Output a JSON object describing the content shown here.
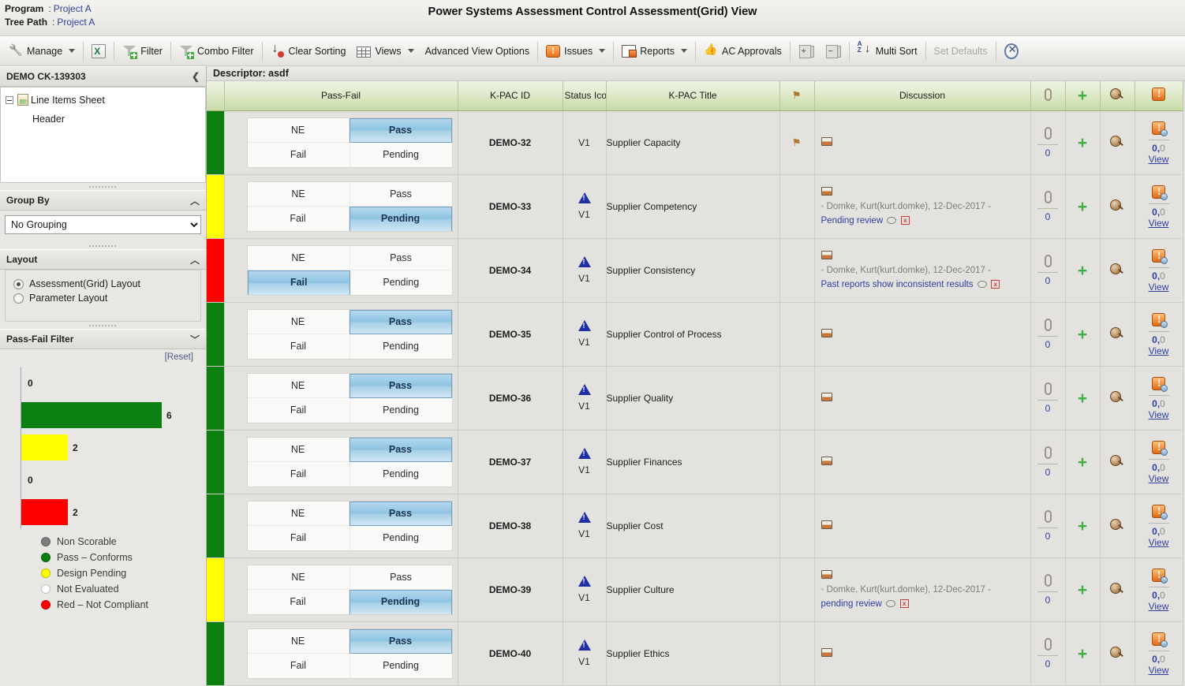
{
  "header": {
    "program_label": "Program",
    "program_value": "Project A",
    "treepath_label": "Tree Path",
    "treepath_value": "Project A",
    "separator": ":",
    "title": "Power Systems Assessment Control Assessment(Grid) View"
  },
  "toolbar": {
    "items": [
      {
        "label": "Manage",
        "icon": "wrench-icon",
        "caret": true,
        "disabled": false
      },
      {
        "label": "",
        "icon": "excel-export-icon",
        "caret": false,
        "disabled": false
      },
      {
        "label": "Filter",
        "icon": "filter-icon",
        "caret": false,
        "disabled": false
      },
      {
        "label": "Combo Filter",
        "icon": "combo-filter-icon",
        "caret": false,
        "disabled": false
      },
      {
        "label": "Clear Sorting",
        "icon": "clear-sorting-icon",
        "caret": false,
        "disabled": false
      },
      {
        "label": "Views",
        "icon": "views-grid-icon",
        "caret": true,
        "disabled": false
      },
      {
        "label": "Advanced View Options",
        "icon": "",
        "caret": false,
        "disabled": false
      },
      {
        "label": "Issues",
        "icon": "issues-icon",
        "caret": true,
        "disabled": false
      },
      {
        "label": "Reports",
        "icon": "reports-icon",
        "caret": true,
        "disabled": false
      },
      {
        "label": "AC Approvals",
        "icon": "thumbs-up-icon",
        "caret": false,
        "disabled": false
      },
      {
        "label": "",
        "icon": "add-copy-icon",
        "caret": false,
        "disabled": true
      },
      {
        "label": "",
        "icon": "remove-copy-icon",
        "caret": false,
        "disabled": true
      },
      {
        "label": "Multi Sort",
        "icon": "sort-az-icon",
        "caret": false,
        "disabled": false
      },
      {
        "label": "Set Defaults",
        "icon": "",
        "caret": false,
        "disabled": true
      },
      {
        "label": "",
        "icon": "close-circle-icon",
        "caret": false,
        "disabled": false
      }
    ]
  },
  "sidebar": {
    "tree_panel": {
      "title": "DEMO CK-139303",
      "collapse_icon": "chevron-left-icon",
      "root_label": "Line Items Sheet",
      "child_label": "Header"
    },
    "group_by": {
      "title": "Group By",
      "chevron": "chevron-up-icon",
      "selected": "No Grouping",
      "options": [
        "No Grouping"
      ]
    },
    "layout": {
      "title": "Layout",
      "chevron": "chevron-up-icon",
      "options": [
        {
          "label": "Assessment(Grid) Layout",
          "selected": true
        },
        {
          "label": "Parameter Layout",
          "selected": false
        }
      ]
    },
    "pass_fail_filter": {
      "title": "Pass-Fail Filter",
      "chevron": "chevron-down-icon",
      "reset_label": "[Reset]"
    }
  },
  "chart_data": {
    "type": "bar",
    "orientation": "horizontal",
    "title": "Pass-Fail Filter",
    "categories": [
      "Non Scorable",
      "Pass – Conforms",
      "Design Pending",
      "Not Evaluated",
      "Red – Not Compliant"
    ],
    "values": [
      0,
      6,
      2,
      0,
      2
    ],
    "colors": [
      "#7d7d7d",
      "#0b8010",
      "#ffff00",
      "#ffffff",
      "#ff0000"
    ],
    "value_labels": [
      "0",
      "6",
      "2",
      "0",
      "2"
    ],
    "xlabel": "",
    "ylabel": "",
    "xlim": [
      0,
      6
    ],
    "grid": false,
    "legend": [
      {
        "label": "Non Scorable",
        "color": "#7d7d7d"
      },
      {
        "label": "Pass – Conforms",
        "color": "#0b8010"
      },
      {
        "label": "Design Pending",
        "color": "#ffff00"
      },
      {
        "label": "Not Evaluated",
        "color": "#ffffff"
      },
      {
        "label": "Red – Not Compliant",
        "color": "#ff0000"
      }
    ],
    "legend_position": "below"
  },
  "grid": {
    "descriptor_label": "Descriptor: asdf",
    "columns": [
      {
        "key": "swatch",
        "label": ""
      },
      {
        "key": "passfail",
        "label": "Pass-Fail"
      },
      {
        "key": "kpac_id",
        "label": "K-PAC ID"
      },
      {
        "key": "status",
        "label": "Status Ico"
      },
      {
        "key": "title",
        "label": "K-PAC Title"
      },
      {
        "key": "flag",
        "label": "",
        "icon": "flag-icon"
      },
      {
        "key": "discussion",
        "label": "Discussion"
      },
      {
        "key": "attach",
        "label": "",
        "icon": "paperclip-icon"
      },
      {
        "key": "add",
        "label": "",
        "icon": "plus-icon"
      },
      {
        "key": "inspect",
        "label": "",
        "icon": "magnifier-icon"
      },
      {
        "key": "issues",
        "label": "",
        "icon": "issue-icon"
      }
    ],
    "passfail_options": {
      "ne": "NE",
      "pass": "Pass",
      "fail": "Fail",
      "pending": "Pending"
    },
    "attach_count": "0",
    "issue_counts_primary": "0,",
    "issue_counts_secondary": "0",
    "view_label": "View",
    "rows": [
      {
        "swatch": "#0b8010",
        "selected": "pass",
        "kpac_id": "DEMO-32",
        "status_warn": false,
        "version": "V1",
        "title": "Supplier Capacity",
        "flag": true,
        "discussion": null
      },
      {
        "swatch": "#ffff00",
        "selected": "pending",
        "kpac_id": "DEMO-33",
        "status_warn": true,
        "version": "V1",
        "title": "Supplier Competency",
        "flag": false,
        "discussion": {
          "author": "Domke, Kurt(kurt.domke), 12-Dec-2017 -",
          "text": "Pending review"
        }
      },
      {
        "swatch": "#ff0000",
        "selected": "fail",
        "kpac_id": "DEMO-34",
        "status_warn": true,
        "version": "V1",
        "title": "Supplier Consistency",
        "flag": false,
        "discussion": {
          "author": "Domke, Kurt(kurt.domke), 12-Dec-2017 -",
          "text": "Past reports show inconsistent results"
        }
      },
      {
        "swatch": "#0b8010",
        "selected": "pass",
        "kpac_id": "DEMO-35",
        "status_warn": true,
        "version": "V1",
        "title": "Supplier Control of Process",
        "flag": false,
        "discussion": null
      },
      {
        "swatch": "#0b8010",
        "selected": "pass",
        "kpac_id": "DEMO-36",
        "status_warn": true,
        "version": "V1",
        "title": "Supplier Quality",
        "flag": false,
        "discussion": null
      },
      {
        "swatch": "#0b8010",
        "selected": "pass",
        "kpac_id": "DEMO-37",
        "status_warn": true,
        "version": "V1",
        "title": "Supplier Finances",
        "flag": false,
        "discussion": null
      },
      {
        "swatch": "#0b8010",
        "selected": "pass",
        "kpac_id": "DEMO-38",
        "status_warn": true,
        "version": "V1",
        "title": "Supplier Cost",
        "flag": false,
        "discussion": null
      },
      {
        "swatch": "#ffff00",
        "selected": "pending",
        "kpac_id": "DEMO-39",
        "status_warn": true,
        "version": "V1",
        "title": "Supplier Culture",
        "flag": false,
        "discussion": {
          "author": "Domke, Kurt(kurt.domke), 12-Dec-2017 -",
          "text": "pending review"
        }
      },
      {
        "swatch": "#0b8010",
        "selected": "pass",
        "kpac_id": "DEMO-40",
        "status_warn": true,
        "version": "V1",
        "title": "Supplier Ethics",
        "flag": false,
        "discussion": null
      }
    ]
  }
}
